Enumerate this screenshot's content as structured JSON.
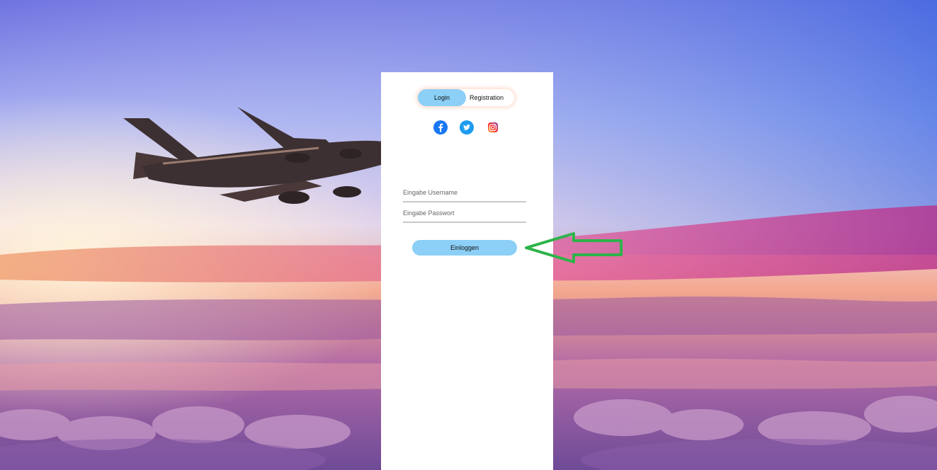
{
  "tabs": {
    "login_label": "Login",
    "registration_label": "Registration",
    "active": "Login"
  },
  "social": {
    "icons": [
      "facebook-icon",
      "twitter-icon",
      "instagram-icon"
    ]
  },
  "form": {
    "username_placeholder": "Eingabe Username",
    "username_value": "",
    "password_placeholder": "Eingabe Passwort",
    "password_value": "",
    "submit_label": "Einloggen"
  },
  "colors": {
    "accent": "#8ccff7",
    "annotation_arrow": "#2db34a",
    "panel_background": "#ffffff"
  }
}
